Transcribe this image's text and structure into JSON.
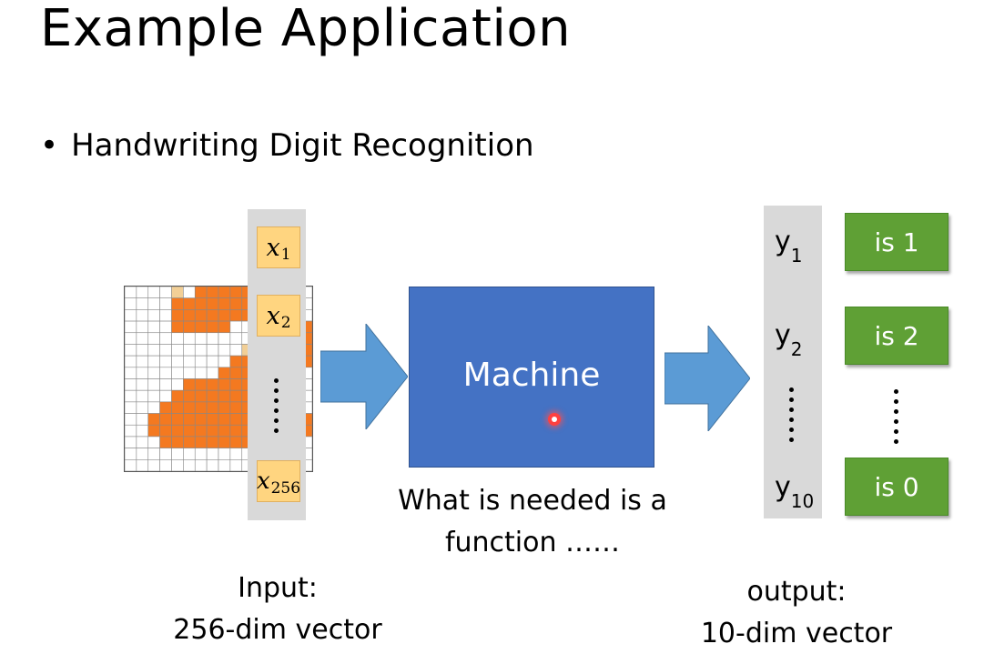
{
  "slide": {
    "title": "Example Application",
    "bullet": "Handwriting Digit Recognition"
  },
  "input_column": {
    "cells": [
      {
        "var": "x",
        "sub": "1"
      },
      {
        "var": "x",
        "sub": "2"
      },
      {
        "var": "x",
        "sub": "256"
      }
    ]
  },
  "machine": {
    "label": "Machine",
    "caption_line1": "What is needed is a",
    "caption_line2": "function ……"
  },
  "output_column": {
    "labels": [
      {
        "var": "y",
        "sub": "1"
      },
      {
        "var": "y",
        "sub": "2"
      },
      {
        "var": "y",
        "sub": "10"
      }
    ],
    "results": [
      "is 1",
      "is 2",
      "is 0"
    ]
  },
  "captions": {
    "input_line1": "Input:",
    "input_line2": "256-dim vector",
    "output_line1": "output:",
    "output_line2": "10-dim vector"
  },
  "colors": {
    "machine": "#4472c4",
    "arrow": "#5b9bd5",
    "result_box": "#5fa035",
    "digit_fill": "#f47920",
    "digit_edge": "#f2cf96",
    "column_bg": "#d9d9d9"
  }
}
